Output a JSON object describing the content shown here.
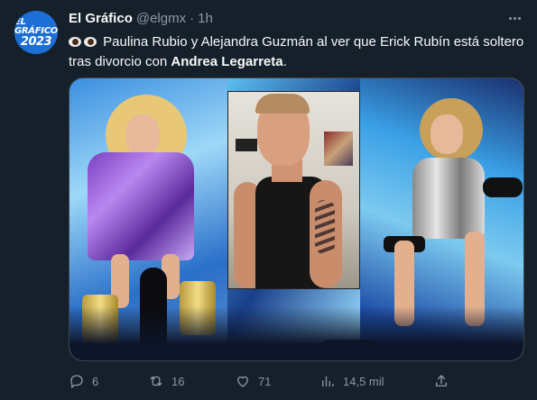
{
  "account": {
    "name": "El Gráfico",
    "handle": "@elgmx",
    "separator": "·",
    "time": "1h",
    "avatar_line1": "EL GRÁFICO",
    "avatar_line2": "2023",
    "avatar_color": "#1d6fd6"
  },
  "tweet": {
    "text_main": "Paulina Rubio y Alejandra Guzmán al ver que Erick Rubín está soltero tras divorcio con ",
    "text_bold": "Andrea Legarreta",
    "text_end": ".",
    "emoji": [
      "eyes-emoji",
      "eyes-emoji"
    ]
  },
  "metrics": {
    "replies": "6",
    "retweets": "16",
    "likes": "71",
    "views": "14,5 mil"
  },
  "icons": {
    "more": "more-icon",
    "reply": "reply-icon",
    "retweet": "retweet-icon",
    "like": "heart-icon",
    "views": "views-icon",
    "share": "share-icon"
  },
  "colors": {
    "background": "#15202b",
    "text": "#f7f9f9",
    "muted": "#8b98a5"
  }
}
